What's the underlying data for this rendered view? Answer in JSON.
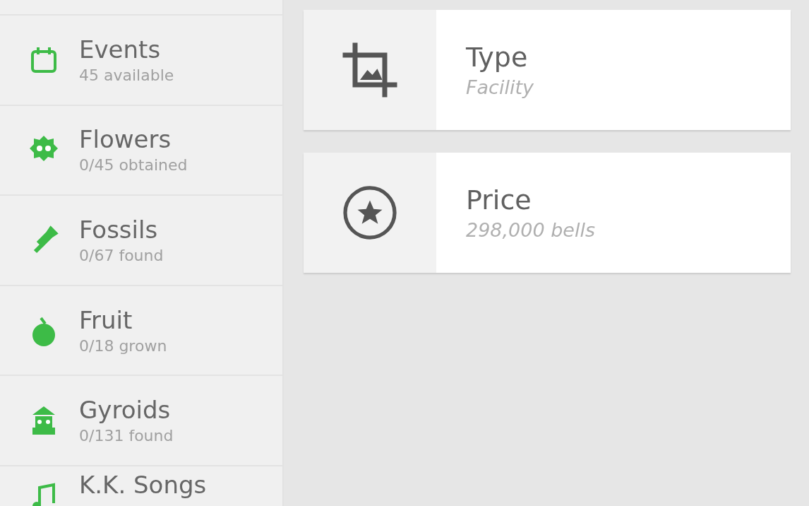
{
  "sidebar": {
    "items": [
      {
        "title": "Events",
        "subtitle": "45 available"
      },
      {
        "title": "Flowers",
        "subtitle": "0/45 obtained"
      },
      {
        "title": "Fossils",
        "subtitle": "0/67 found"
      },
      {
        "title": "Fruit",
        "subtitle": "0/18 grown"
      },
      {
        "title": "Gyroids",
        "subtitle": "0/131 found"
      },
      {
        "title": "K.K. Songs"
      }
    ]
  },
  "details": [
    {
      "label": "Type",
      "value": "Facility"
    },
    {
      "label": "Price",
      "value": "298,000 bells"
    }
  ]
}
